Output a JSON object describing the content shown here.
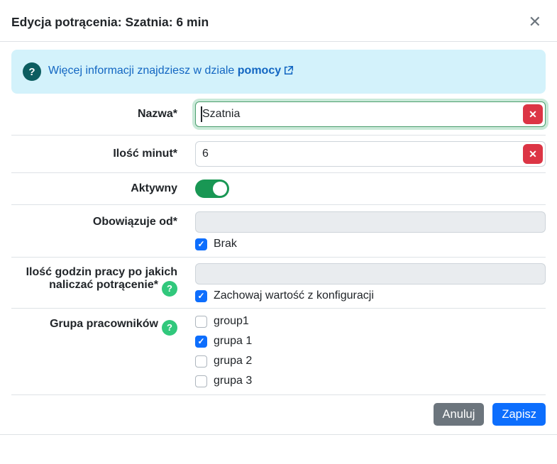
{
  "modal": {
    "title": "Edycja potrącenia: Szatnia: 6 min"
  },
  "icons": {
    "close": "✕",
    "question_mark": "?",
    "clear": "✕",
    "check": "✓"
  },
  "banner": {
    "text": "Więcej informacji znajdziesz w dziale",
    "link_label": "pomocy"
  },
  "form": {
    "nazwa": {
      "label": "Nazwa*",
      "value": "Szatnia"
    },
    "ilosc_minut": {
      "label": "Ilość minut*",
      "value": "6"
    },
    "aktywny": {
      "label": "Aktywny",
      "enabled": true
    },
    "obowiazuje_od": {
      "label": "Obowiązuje od*",
      "value": "",
      "brak_label": "Brak",
      "brak_checked": true
    },
    "ilosc_godzin": {
      "label": "Ilość godzin pracy po jakich naliczać potrącenie*",
      "value": "",
      "checkbox_label": "Zachowaj wartość z konfiguracji",
      "checkbox_checked": true
    },
    "grupa_pracownikow": {
      "label": "Grupa pracowników",
      "options": [
        {
          "label": "group1",
          "checked": false
        },
        {
          "label": "grupa 1",
          "checked": true
        },
        {
          "label": "grupa 2",
          "checked": false
        },
        {
          "label": "grupa 3",
          "checked": false
        }
      ]
    }
  },
  "footer": {
    "cancel_label": "Anuluj",
    "save_label": "Zapisz"
  },
  "colors": {
    "accent_blue": "#0d6efd",
    "secondary_gray": "#6c757d",
    "toggle_green": "#199754",
    "helper_green": "#31c87c",
    "danger_red": "#dc3545",
    "info_banner_bg": "#d3f2fb",
    "info_icon_teal": "#0c5d60",
    "link_blue": "#1266c2"
  }
}
